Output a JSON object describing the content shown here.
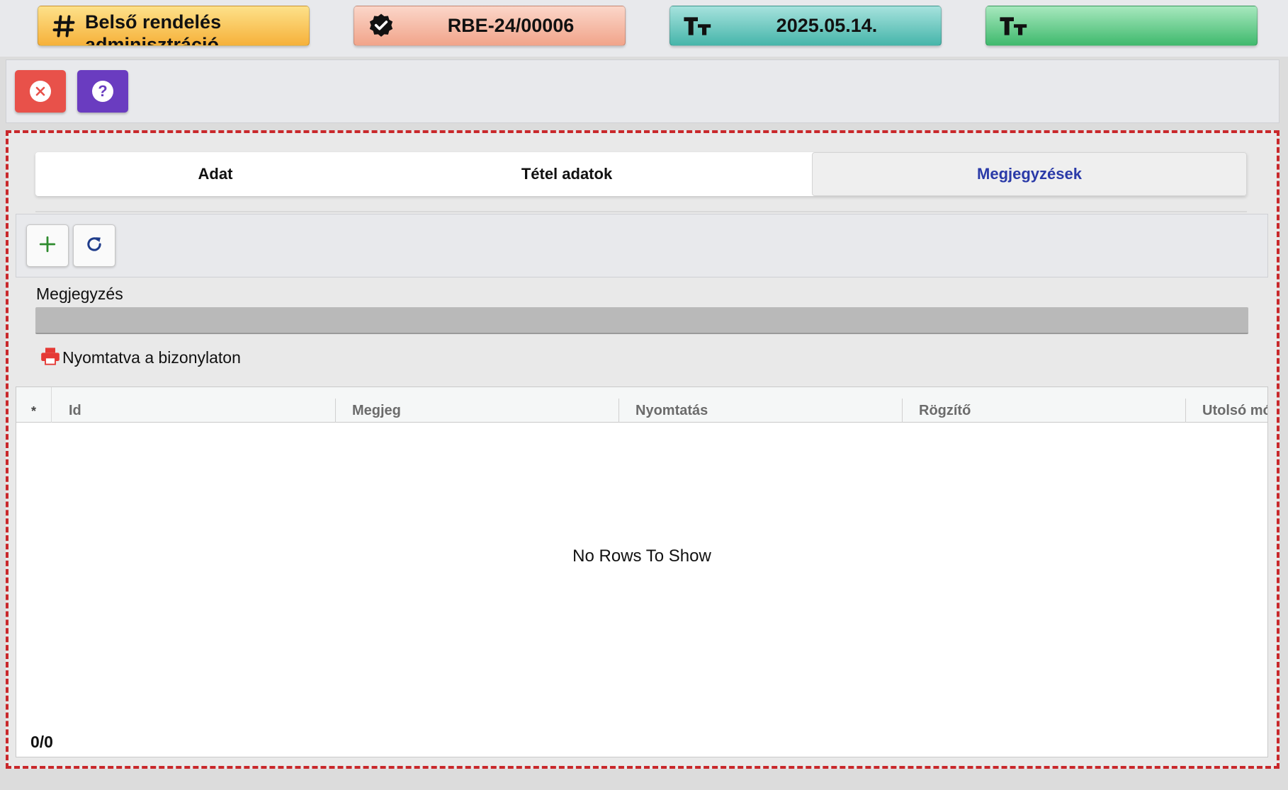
{
  "header": {
    "badges": [
      {
        "label": "Belső rendelés adminisztráció",
        "icon": "hash-icon",
        "color_from": "#fde18a",
        "color_to": "#f6b13a"
      },
      {
        "label": "RBE-24/00006",
        "icon": "verified-badge-icon",
        "color_from": "#fbd6c9",
        "color_to": "#f1a48a"
      },
      {
        "label": "2025.05.14.",
        "icon": "text-size-icon",
        "color_from": "#a6e2dd",
        "color_to": "#46b5aa"
      },
      {
        "label": "",
        "icon": "text-size-icon",
        "color_from": "#a7e8be",
        "color_to": "#3fb96d"
      }
    ]
  },
  "toolbar": {
    "buttons": [
      {
        "icon": "close-circle-icon",
        "color": "#e8514a"
      },
      {
        "icon": "help-circle-icon",
        "color": "#6a3cc0"
      }
    ]
  },
  "tabs": [
    {
      "label": "Adat",
      "active": false
    },
    {
      "label": "Tétel adatok",
      "active": false
    },
    {
      "label": "Megjegyzések",
      "active": true
    }
  ],
  "notes": {
    "toolbar": {
      "add_icon": "plus-icon",
      "refresh_icon": "refresh-icon"
    },
    "field_label": "Megjegyzés",
    "field_value": "",
    "print_label": "Nyomtatva a bizonylaton",
    "print_icon": "printer-icon"
  },
  "grid": {
    "columns": [
      "*",
      "Id",
      "Megjeg",
      "Nyomtatás",
      "Rögzítő",
      "Utolsó mó"
    ],
    "rows": [],
    "empty_text": "No Rows To Show",
    "count": "0/0"
  },
  "colors": {
    "frame_dashed": "#c9282b",
    "active_tab_text": "#2a3aa8"
  }
}
